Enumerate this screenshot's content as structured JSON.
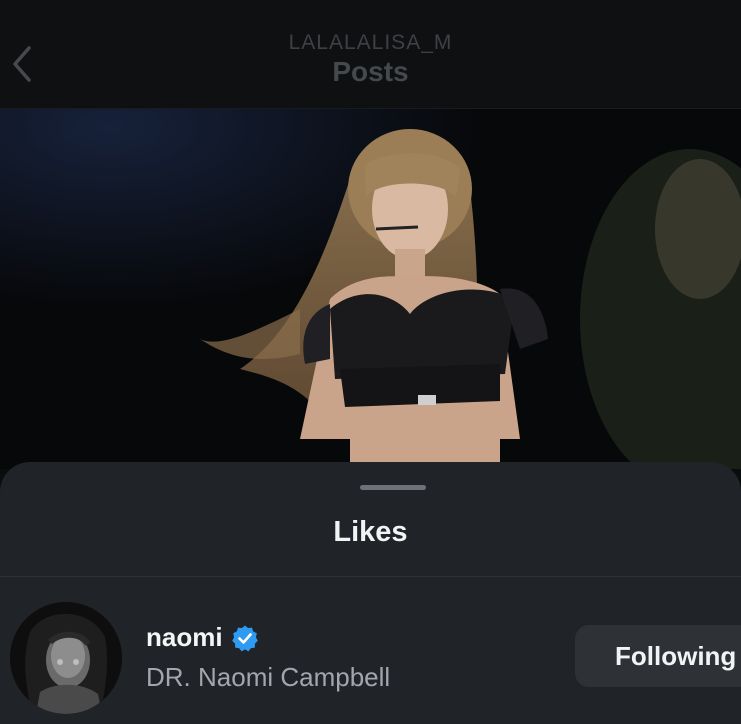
{
  "header": {
    "username": "LALALALISA_M",
    "title": "Posts",
    "back_icon": "chevron-left-icon"
  },
  "post": {
    "image_icon": "concert-photo"
  },
  "sheet": {
    "title": "Likes",
    "likes": [
      {
        "username": "naomi",
        "verified": true,
        "full_name": "DR. Naomi Campbell",
        "follow_label": "Following"
      }
    ]
  },
  "colors": {
    "background": "#0b0c0e",
    "sheet": "#202327",
    "verified_blue": "#2f9bf0",
    "button": "#2e3136"
  }
}
